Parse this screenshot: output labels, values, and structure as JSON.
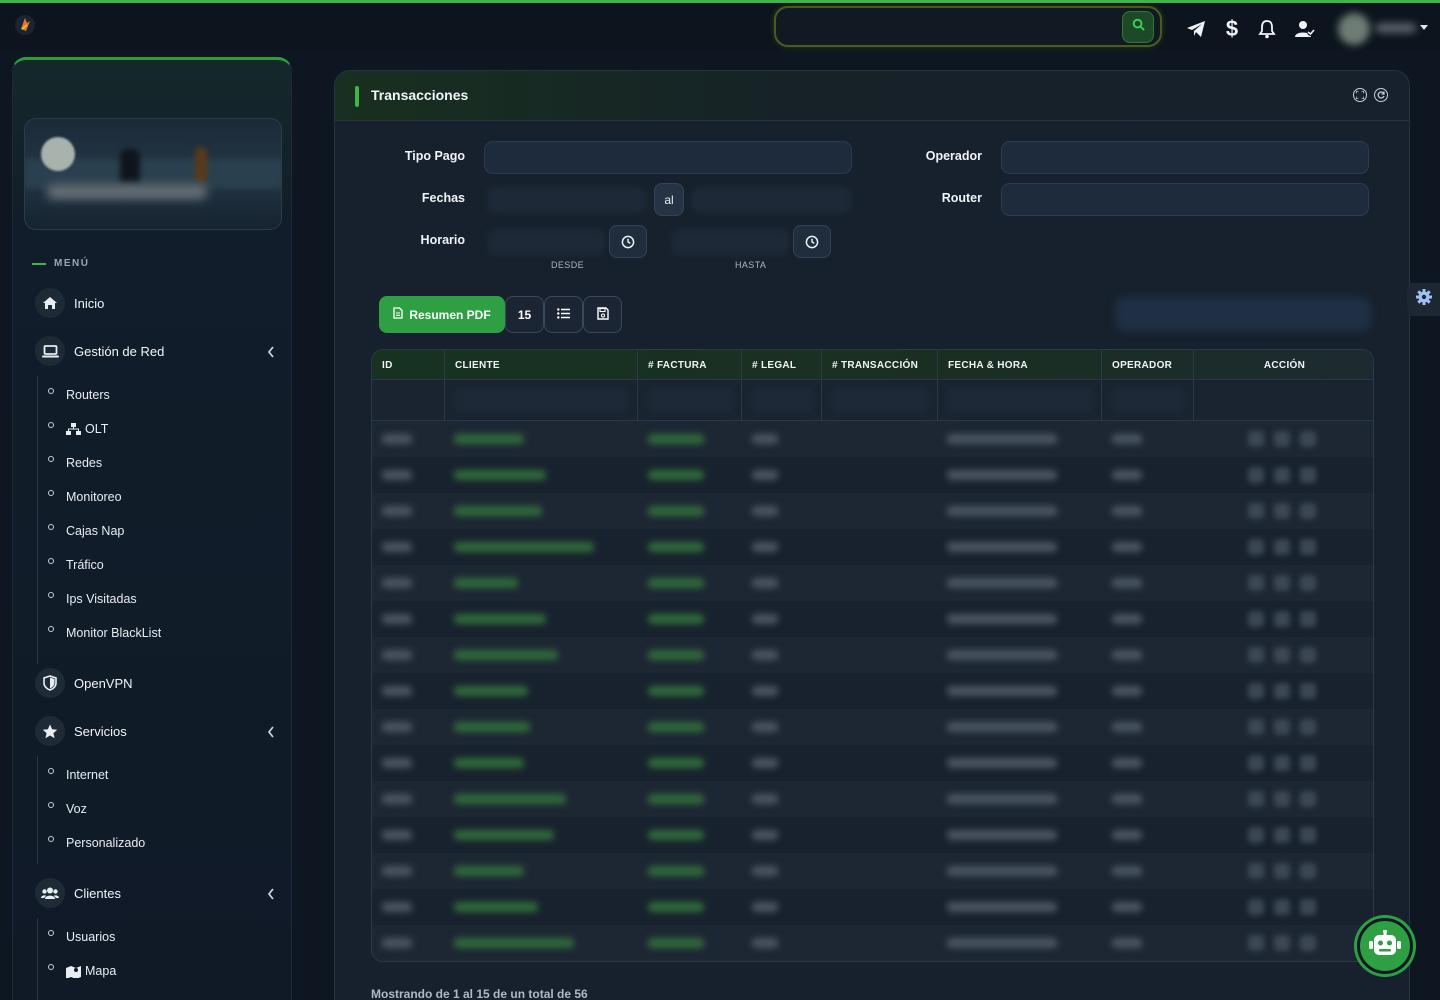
{
  "topbar": {
    "search_placeholder": "",
    "icons": [
      "telegram-icon",
      "dollar-icon",
      "bell-icon",
      "users-icon"
    ]
  },
  "sidebar": {
    "menu_heading": "MENÚ",
    "items": [
      {
        "label": "Inicio",
        "icon": "home-icon"
      },
      {
        "label": "Gestión de Red",
        "icon": "laptop-icon",
        "expanded": true,
        "children": [
          "Routers",
          "OLT",
          "Redes",
          "Monitoreo",
          "Cajas Nap",
          "Tráfico",
          "Ips Visitadas",
          "Monitor BlackList"
        ]
      },
      {
        "label": "OpenVPN",
        "icon": "shield-icon"
      },
      {
        "label": "Servicios",
        "icon": "star-icon",
        "expanded": true,
        "children": [
          "Internet",
          "Voz",
          "Personalizado"
        ]
      },
      {
        "label": "Clientes",
        "icon": "users-icon",
        "expanded": true,
        "children": [
          "Usuarios",
          "Mapa"
        ]
      }
    ]
  },
  "card": {
    "title": "Transacciones",
    "filters": {
      "tipo_pago_label": "Tipo Pago",
      "operador_label": "Operador",
      "fechas_label": "Fechas",
      "router_label": "Router",
      "horario_label": "Horario",
      "al_text": "al",
      "desde_hint": "DESDE",
      "hasta_hint": "HASTA"
    },
    "toolbar": {
      "pdf_label": "Resumen PDF",
      "page_size": "15"
    },
    "table": {
      "columns": [
        "ID",
        "CLIENTE",
        "# FACTURA",
        "# LEGAL",
        "# TRANSACCIÓN",
        "FECHA & HORA",
        "OPERADOR",
        "ACCIÓN"
      ],
      "row_count": 15
    },
    "footer": "Mostrando de 1 al 15 de un total de 56"
  },
  "colors": {
    "accent": "#3fb54a",
    "button_green": "#2ea043",
    "background": "#0e1622",
    "card": "#17212d"
  }
}
